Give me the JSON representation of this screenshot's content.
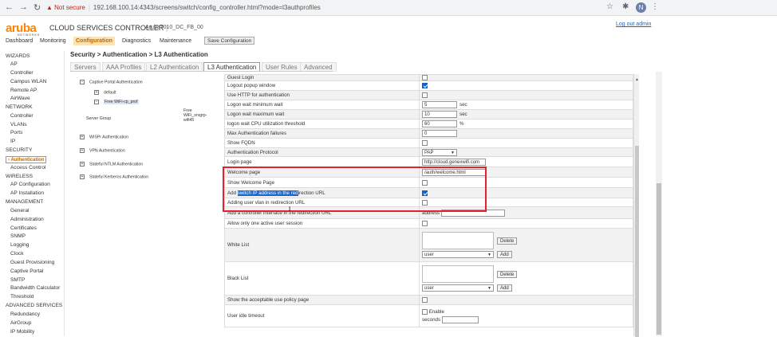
{
  "browser": {
    "security": "Not secure",
    "url": "192.168.100.14:4343/screens/switch/config_controller.html?mode=l3authprofiles",
    "avatar_letter": "N"
  },
  "header": {
    "logo": "aruba",
    "logo_sub": "NETWORKS",
    "title": "CLOUD SERVICES CONTROLLER",
    "controller": "Aruba7010_DC_FB_00",
    "logout": "Log out admin"
  },
  "topnav": {
    "items": [
      "Dashboard",
      "Monitoring",
      "Configuration",
      "Diagnostics",
      "Maintenance"
    ],
    "save": "Save Configuration"
  },
  "sidebar": {
    "sections": [
      {
        "title": "WIZARDS",
        "items": [
          "AP",
          "Controller",
          "Campus WLAN",
          "Remote AP",
          "AirWave"
        ]
      },
      {
        "title": "NETWORK",
        "items": [
          "Controller",
          "VLANs",
          "Ports",
          "IP"
        ]
      },
      {
        "title": "SECURITY",
        "items": [
          "Authentication",
          "Access Control"
        ]
      },
      {
        "title": "WIRELESS",
        "items": [
          "AP Configuration",
          "AP Installation"
        ]
      },
      {
        "title": "MANAGEMENT",
        "items": [
          "General",
          "Administration",
          "Certificates",
          "SNMP",
          "Logging",
          "Clock",
          "Guest Provisioning",
          "Captive Portal",
          "SMTP",
          "Bandwidth Calculator",
          "Threshold"
        ]
      },
      {
        "title": "ADVANCED SERVICES",
        "items": [
          "Redundancy",
          "AirGroup",
          "IP Mobility"
        ]
      }
    ]
  },
  "breadcrumb": "Security > Authentication > L3 Authentication",
  "tabs": [
    "Servers",
    "AAA Profiles",
    "L2 Authentication",
    "L3 Authentication",
    "User Rules",
    "Advanced"
  ],
  "tree": {
    "captive": "Captive Portal Authentication",
    "default": "default",
    "profile": "Free WiFi-cp_prof",
    "server_group_label": "Server Group",
    "server_group_value": "Free WiFi_srvgrp-wifi45",
    "wispr": "WISPr Authentication",
    "vpn": "VPN Authentication",
    "ntlm": "Stateful NTLM Authentication",
    "kerberos": "Stateful Kerberos Authentication"
  },
  "rows": {
    "guest_login": "Guest Login",
    "logout_popup": "Logout popup window",
    "use_http": "Use HTTP for authentication",
    "min_wait": "Logon wait minimum wait",
    "min_wait_val": "5",
    "max_wait": "Logon wait maximum wait",
    "max_wait_val": "10",
    "cpu": "logon wait CPU utilization threshold",
    "cpu_val": "60",
    "max_fail": "Max Authentication failures",
    "max_fail_val": "0",
    "fqdn": "Show FQDN",
    "protocol": "Authentication Protocol",
    "protocol_val": "PAP",
    "login_page": "Login page",
    "login_page_val": "http://cloud.genexwifi.com",
    "welcome_page": "Welcome page",
    "welcome_page_val": "/auth/welcome.html",
    "show_welcome": "Show Welcome Page",
    "add_ip_pre": "Add ",
    "add_ip_hl": "switch IP address in the red",
    "add_ip_post": "irection URL",
    "add_vlan": "Adding user vlan in redirection URL",
    "add_iface": "Add a controller interface in the redirection URL",
    "address": "address",
    "one_session": "Allow only one active user session",
    "white_list": "White List",
    "black_list": "Black List",
    "delete": "Delete",
    "user": "user",
    "add": "Add",
    "aup": "Show the acceptable use policy page",
    "idle": "User idle timeout",
    "enable": "Enable",
    "seconds": "seconds",
    "sec": "sec",
    "pct": "%"
  }
}
